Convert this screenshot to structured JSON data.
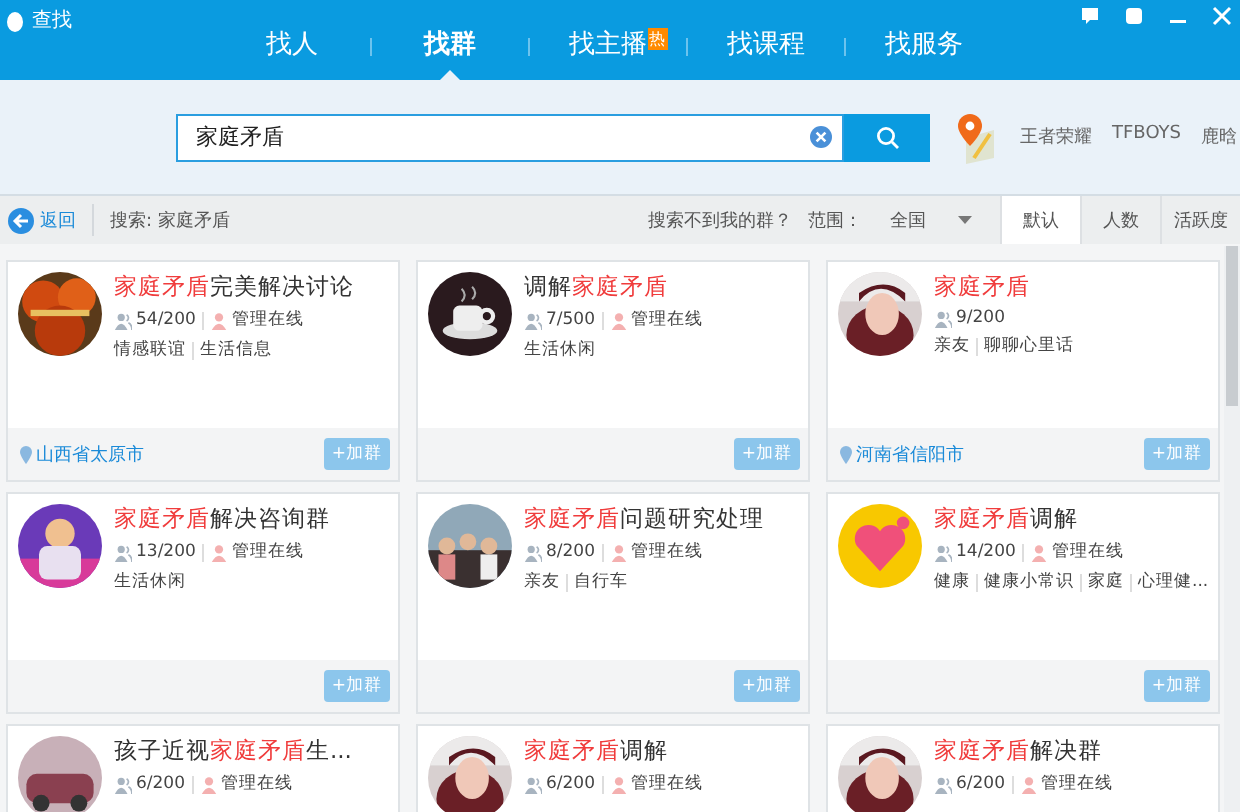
{
  "window": {
    "title": "查找"
  },
  "tabs": [
    {
      "label": "找人",
      "selected": false
    },
    {
      "label": "找群",
      "selected": true
    },
    {
      "label": "找主播",
      "selected": false,
      "badge": "热"
    },
    {
      "label": "找课程",
      "selected": false
    },
    {
      "label": "找服务",
      "selected": false
    }
  ],
  "search": {
    "value": "家庭矛盾"
  },
  "hot_keywords": [
    "王者荣耀",
    "TFBOYS",
    "鹿晗"
  ],
  "filter_bar": {
    "back": "返回",
    "query": "搜索: 家庭矛盾",
    "not_found": "搜索不到我的群？",
    "range_label": "范围：",
    "range_value": "全国",
    "sort_tabs": [
      {
        "label": "默认",
        "selected": true
      },
      {
        "label": "人数",
        "selected": false
      },
      {
        "label": "活跃度",
        "selected": false
      }
    ]
  },
  "groups": [
    {
      "title": [
        {
          "text": "家庭矛盾",
          "highlight": true
        },
        {
          "text": "完美解决讨论",
          "highlight": false
        }
      ],
      "members": "54/200",
      "admin": "管理在线",
      "tags": [
        "情感联谊",
        "生活信息"
      ],
      "location": "山西省太原市",
      "join": "+加群"
    },
    {
      "title": [
        {
          "text": "调解",
          "highlight": false
        },
        {
          "text": "家庭矛盾",
          "highlight": true
        }
      ],
      "members": "7/500",
      "admin": "管理在线",
      "tags": [
        "生活休闲"
      ],
      "join": "+加群"
    },
    {
      "title": [
        {
          "text": "家庭矛盾",
          "highlight": true
        }
      ],
      "members": "9/200",
      "tags": [
        "亲友",
        "聊聊心里话"
      ],
      "location": "河南省信阳市",
      "join": "+加群"
    },
    {
      "title": [
        {
          "text": "家庭矛盾",
          "highlight": true
        },
        {
          "text": "解决咨询群",
          "highlight": false
        }
      ],
      "members": "13/200",
      "admin": "管理在线",
      "tags": [
        "生活休闲"
      ],
      "join": "+加群"
    },
    {
      "title": [
        {
          "text": "家庭矛盾",
          "highlight": true
        },
        {
          "text": "问题研究处理",
          "highlight": false
        }
      ],
      "members": "8/200",
      "admin": "管理在线",
      "tags": [
        "亲友",
        "自行车"
      ],
      "join": "+加群"
    },
    {
      "title": [
        {
          "text": "家庭矛盾",
          "highlight": true
        },
        {
          "text": "调解",
          "highlight": false
        }
      ],
      "members": "14/200",
      "admin": "管理在线",
      "tags": [
        "健康",
        "健康小常识",
        "家庭",
        "心理健..."
      ],
      "join": "+加群"
    },
    {
      "title": [
        {
          "text": "孩子近视",
          "highlight": false
        },
        {
          "text": "家庭矛盾",
          "highlight": true
        },
        {
          "text": "生...",
          "highlight": false
        }
      ],
      "members": "6/200",
      "admin": "管理在线"
    },
    {
      "title": [
        {
          "text": "家庭矛盾",
          "highlight": true
        },
        {
          "text": "调解",
          "highlight": false
        }
      ],
      "members": "6/200",
      "admin": "管理在线"
    },
    {
      "title": [
        {
          "text": "家庭矛盾",
          "highlight": true
        },
        {
          "text": "解决群",
          "highlight": false
        }
      ],
      "members": "6/200",
      "admin": "管理在线"
    }
  ]
}
